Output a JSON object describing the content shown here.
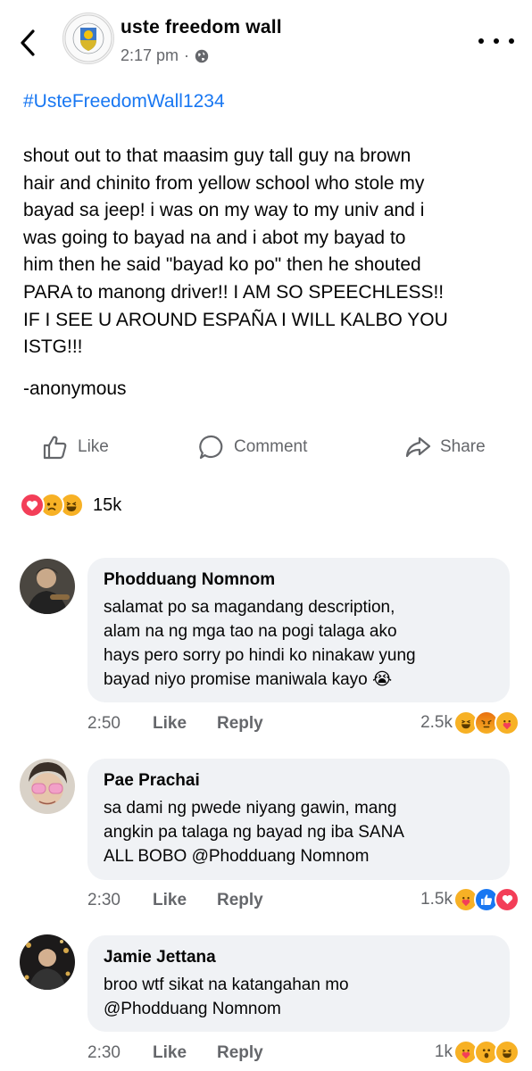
{
  "header": {
    "page_name": "uste freedom wall",
    "time": "2:17 pm",
    "separator": "·"
  },
  "post": {
    "hashtag": "#UsteFreedomWall1234",
    "lines": [
      "shout out to that maasim guy tall guy na brown",
      "hair and chinito from yellow school who stole my",
      "bayad sa jeep! i was on my way to my univ and i",
      "was going to bayad na and i abot my bayad to",
      "him then he said \"bayad ko po\" then he shouted",
      "PARA to manong driver!! I AM SO SPEECHLESS!!",
      "IF I SEE U AROUND ESPAÑA I WILL KALBO YOU",
      "ISTG!!!"
    ],
    "signature": "-anonymous"
  },
  "actions": {
    "like_label": "Like",
    "comment_label": "Comment",
    "share_label": "Share"
  },
  "reactions": {
    "count": "15k",
    "icons": [
      "love-icon",
      "sad-icon",
      "haha-icon"
    ]
  },
  "comments": [
    {
      "name": "Phodduang Nomnom",
      "lines": [
        "salamat po sa magandang description,",
        "alam na ng mga tao na pogi talaga ako",
        "hays pero sorry po hindi ko ninakaw yung",
        "bayad niyo promise maniwala kayo 😭"
      ],
      "time": "2:50",
      "like_label": "Like",
      "reply_label": "Reply",
      "reaction_count": "2.5k",
      "reaction_icons": [
        "haha-icon",
        "angry-icon",
        "care-icon"
      ]
    },
    {
      "name": "Pae Prachai",
      "lines": [
        "sa dami ng pwede niyang gawin, mang",
        "angkin pa talaga ng bayad ng iba SANA",
        "ALL BOBO @Phodduang Nomnom"
      ],
      "time": "2:30",
      "like_label": "Like",
      "reply_label": "Reply",
      "reaction_count": "1.5k",
      "reaction_icons": [
        "care-icon",
        "like-icon",
        "love-icon"
      ]
    },
    {
      "name": "Jamie Jettana",
      "lines": [
        "broo wtf sikat na katangahan mo",
        "@Phodduang Nomnom"
      ],
      "time": "2:30",
      "like_label": "Like",
      "reply_label": "Reply",
      "reaction_count": "1k",
      "reaction_icons": [
        "care-icon",
        "wow-icon",
        "haha-icon"
      ]
    }
  ],
  "colors": {
    "link": "#1877f2",
    "secondary_text": "#65676b",
    "bubble": "#f0f2f5",
    "love": "#f33e58",
    "yellow": "#f7b125",
    "like": "#1877f2",
    "angry": "#e9710f"
  }
}
